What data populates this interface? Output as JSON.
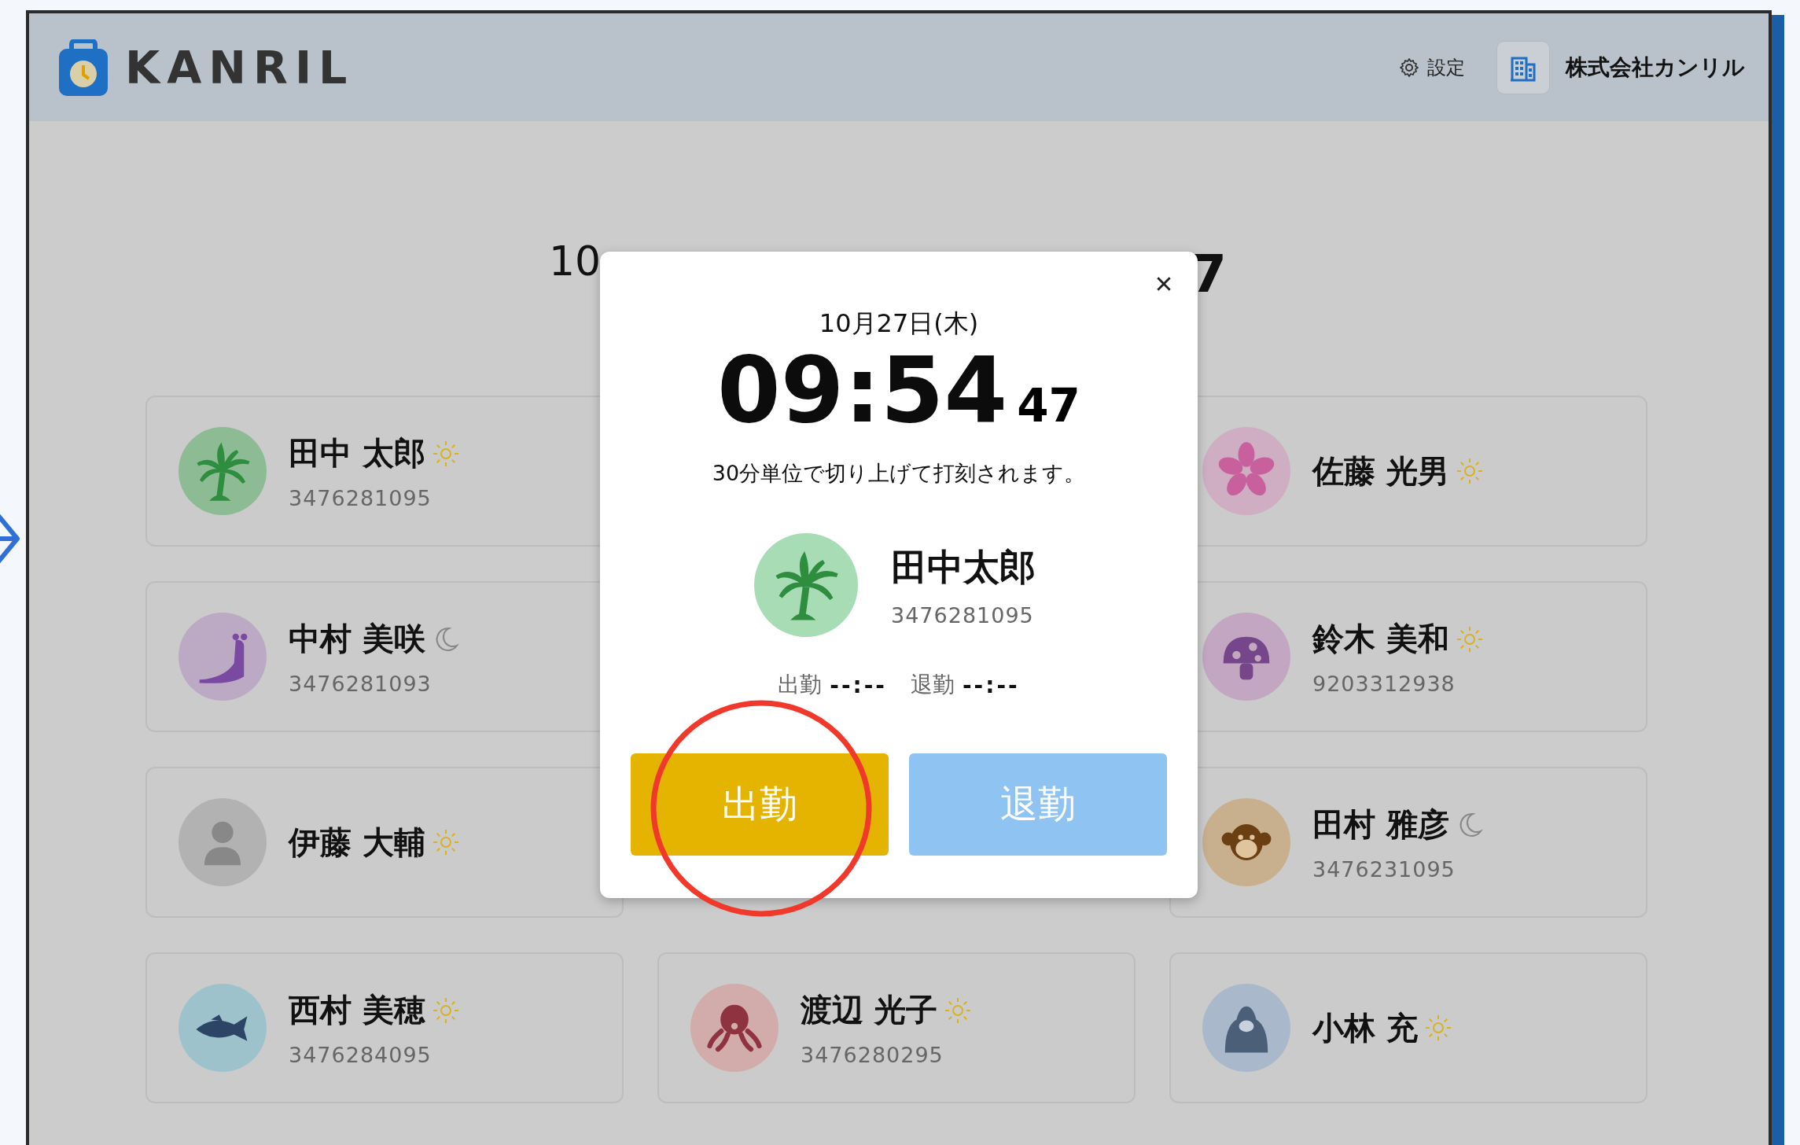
{
  "header": {
    "brand": "KANRIL",
    "settings_label": "設定",
    "company": "株式会社カンリル"
  },
  "clock": {
    "date": "10",
    "seconds": "7"
  },
  "employees": [
    {
      "name": "田中 太郎",
      "id": "3476281095",
      "kind": "palm",
      "night": false,
      "color": "#8dbb93"
    },
    {
      "name": "佐藤 光男",
      "kind": "flower",
      "night": false,
      "color": "#cfaec4"
    },
    {
      "name": "中村 美咲",
      "id": "3476281093",
      "kind": "slug",
      "night": true,
      "color": "#bca9c3"
    },
    {
      "name": "鈴木 美和",
      "id": "9203312938",
      "kind": "mushroom",
      "night": false,
      "color": "#c2a6c2"
    },
    {
      "name": "伊藤 大輔",
      "kind": "person",
      "night": false,
      "color": "#b2b2b2"
    },
    {
      "name": "田村 雅彦",
      "id": "3476231095",
      "kind": "monkey",
      "night": true,
      "color": "#c8b08e"
    },
    {
      "name": "西村 美穂",
      "id": "3476284095",
      "kind": "fish",
      "night": false,
      "color": "#9ec2cc"
    },
    {
      "name": "渡辺 光子",
      "id": "3476280295",
      "kind": "octopus",
      "night": false,
      "color": "#d2abab"
    },
    {
      "name": "小林 充",
      "kind": "gorilla",
      "night": false,
      "color": "#a9b9cb"
    }
  ],
  "modal": {
    "date": "10月27日(木)",
    "time": "09:54",
    "seconds": "47",
    "note": "30分単位で切り上げて打刻されます。",
    "employee": {
      "name": "田中太郎",
      "id": "3476281095",
      "kind": "palm",
      "color": "#a8dcb4"
    },
    "records": [
      {
        "label": "出勤",
        "value": "--:--"
      },
      {
        "label": "退勤",
        "value": "--:--"
      }
    ],
    "buttons": [
      {
        "label": "出勤",
        "color": "#e5b400",
        "circled": true
      },
      {
        "label": "退勤",
        "color": "#8ec3f2",
        "circled": false
      }
    ]
  }
}
